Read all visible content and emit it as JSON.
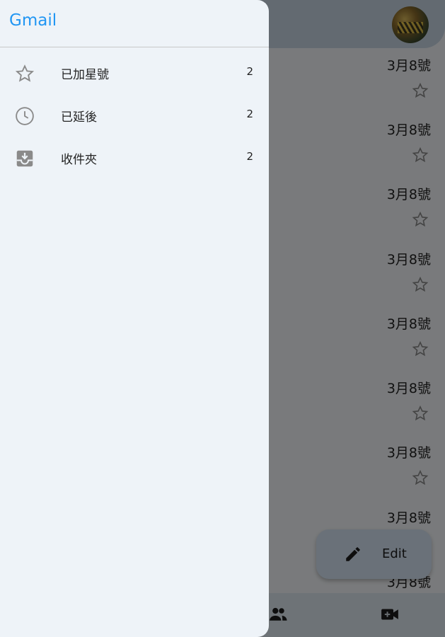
{
  "drawer": {
    "title": "Gmail",
    "items": [
      {
        "label": "已加星號",
        "count": "2",
        "icon": "star-outline-icon"
      },
      {
        "label": "已延後",
        "count": "2",
        "icon": "clock-icon"
      },
      {
        "label": "收件夾",
        "count": "2",
        "icon": "inbox-icon"
      }
    ]
  },
  "mail_list": {
    "dates": [
      "3月8號",
      "3月8號",
      "3月8號",
      "3月8號",
      "3月8號",
      "3月8號",
      "3月8號",
      "3月8號",
      "3月8號"
    ]
  },
  "fab": {
    "label": "Edit",
    "icon": "pencil-icon"
  },
  "bottom_nav": {
    "icons": [
      "people-icon",
      "video-camera-icon"
    ]
  },
  "colors": {
    "accent": "#2196f3",
    "drawer_bg": "#eef3f8",
    "scrim": "rgba(0,0,0,0.5)"
  }
}
